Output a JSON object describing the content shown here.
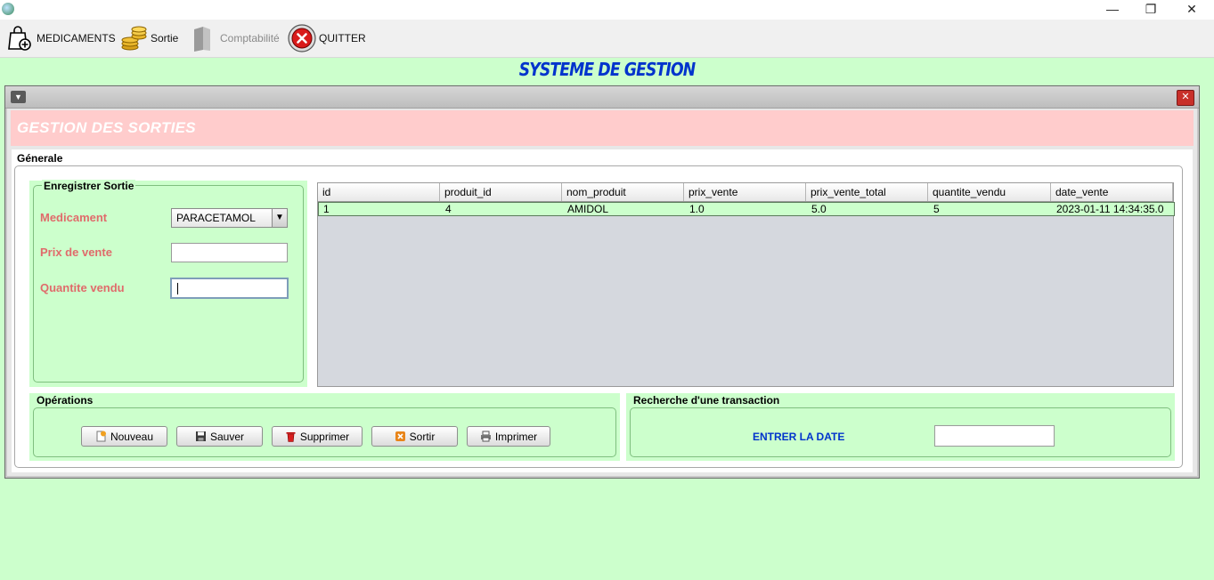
{
  "window": {
    "minimize": "—",
    "restore": "❐",
    "close": "✕"
  },
  "toolbar": {
    "items": [
      {
        "label": "MEDICAMENTS",
        "icon": "medicine-bag-icon",
        "enabled": true
      },
      {
        "label": "Sortie",
        "icon": "coins-icon",
        "enabled": true
      },
      {
        "label": "Comptabilité",
        "icon": "ledger-icon",
        "enabled": false
      },
      {
        "label": "QUITTER",
        "icon": "quit-icon",
        "enabled": true
      }
    ]
  },
  "app": {
    "title": "SYSTEME DE GESTION"
  },
  "internal_frame": {
    "menu_glyph": "▼",
    "close_glyph": "✕",
    "banner_title": "GESTION DES SORTIES",
    "tab_label": "Génerale"
  },
  "form": {
    "legend": "Enregistrer Sortie",
    "medicament_label": "Medicament",
    "medicament_value": "PARACETAMOL",
    "prix_label": "Prix de vente",
    "prix_value": "",
    "quantite_label": "Quantite vendu",
    "quantite_value": ""
  },
  "table": {
    "columns": [
      "id",
      "produit_id",
      "nom_produit",
      "prix_vente",
      "prix_vente_total",
      "quantite_vendu",
      "date_vente"
    ],
    "rows": [
      [
        "1",
        "4",
        "AMIDOL",
        "1.0",
        "5.0",
        "5",
        "2023-01-11 14:34:35.0"
      ]
    ]
  },
  "operations": {
    "legend": "Opérations",
    "buttons": [
      {
        "label": "Nouveau",
        "icon": "new-icon"
      },
      {
        "label": "Sauver",
        "icon": "save-icon"
      },
      {
        "label": "Supprimer",
        "icon": "trash-icon"
      },
      {
        "label": "Sortir",
        "icon": "exit-icon"
      },
      {
        "label": "Imprimer",
        "icon": "printer-icon"
      }
    ]
  },
  "search": {
    "legend": "Recherche d'une transaction",
    "label": "ENTRER LA DATE",
    "value": ""
  },
  "colors": {
    "background": "#ccffcc",
    "banner": "#ffcccc",
    "title_blue": "#0033cc",
    "label_red": "#e06b6b"
  }
}
